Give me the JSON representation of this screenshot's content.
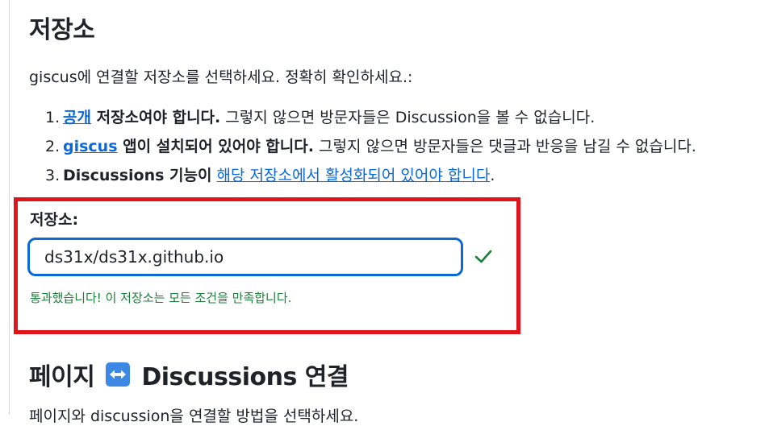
{
  "section_repo": {
    "title": "저장소",
    "intro": "giscus에 연결할 저장소를 선택하세요. 정확히 확인하세요.:",
    "requirements": [
      {
        "num": "1.",
        "link": "공개",
        "bold": " 저장소여야 합니다.",
        "rest": " 그렇지 않으면 방문자들은 Discussion을 볼 수 없습니다."
      },
      {
        "num": "2.",
        "link": "giscus",
        "bold": " 앱이 설치되어 있어야 합니다.",
        "rest": " 그렇지 않으면 방문자들은 댓글과 반응을 남길 수 없습니다."
      },
      {
        "num": "3.",
        "bold": "Discussions 기능이",
        "link": "해당 저장소에서 활성화되어 있어야 합니다",
        "rest": "."
      }
    ],
    "field_label": "저장소:",
    "field_value": "ds31x/ds31x.github.io",
    "status_icon": "check-icon",
    "success_message": "통과했습니다! 이 저장소는 모든 조건을 만족합니다."
  },
  "section_mapping": {
    "title_prefix": "페이지",
    "emoji": "left-right-arrow-icon",
    "title_suffix": "Discussions 연결",
    "partial_text": "페이지와 discussion을 연결할 방법을 선택하세요."
  },
  "colors": {
    "link": "#0969da",
    "success": "#1a7f37",
    "highlight": "#e0151b",
    "input_border": "#0969da"
  }
}
